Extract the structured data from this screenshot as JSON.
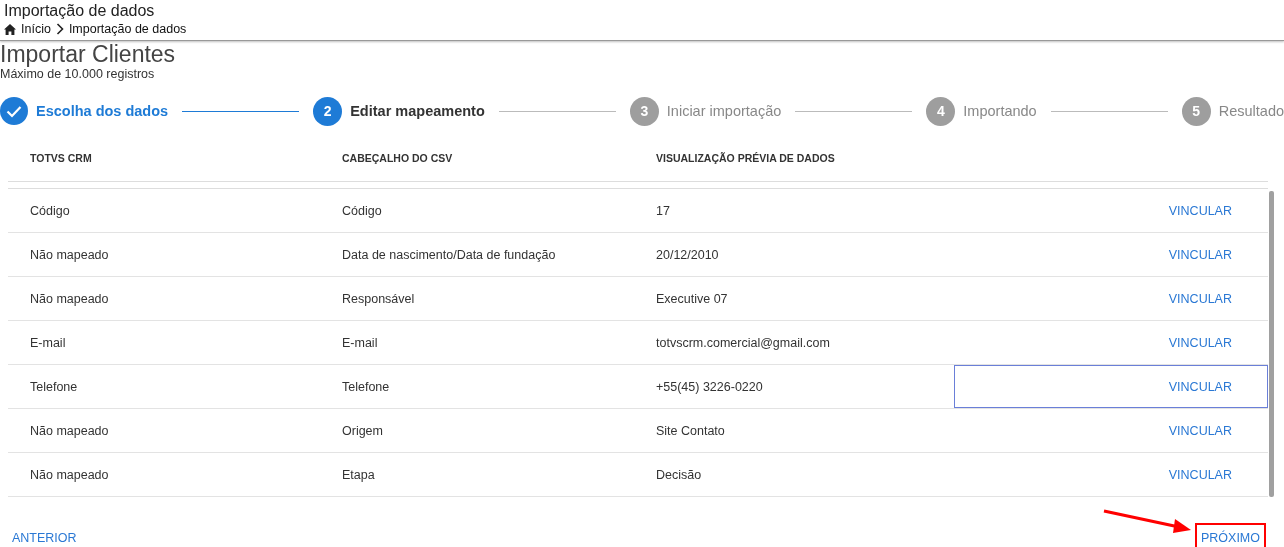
{
  "header": {
    "title": "Importação de dados",
    "breadcrumb": [
      "Início",
      "Importação de dados"
    ]
  },
  "page": {
    "title": "Importar Clientes",
    "subtitle": "Máximo de 10.000 registros"
  },
  "steps": [
    {
      "label": "Escolha dos dados",
      "completed": true,
      "selected": false
    },
    {
      "number": "2",
      "label": "Editar mapeamento",
      "completed": false,
      "selected": true
    },
    {
      "number": "3",
      "label": "Iniciar importação",
      "completed": false,
      "selected": false
    },
    {
      "number": "4",
      "label": "Importando",
      "completed": false,
      "selected": false
    },
    {
      "number": "5",
      "label": "Resultado",
      "completed": false,
      "selected": false
    }
  ],
  "table": {
    "columns": [
      "TOTVS CRM",
      "CABEÇALHO DO CSV",
      "VISUALIZAÇÃO PRÉVIA DE DADOS"
    ],
    "rows": [
      {
        "field": "Código",
        "csv_header": "Código",
        "preview": "17",
        "action": "VINCULAR",
        "focused": false
      },
      {
        "field": "Não mapeado",
        "csv_header": "Data de nascimento/Data de fundação",
        "preview": "20/12/2010",
        "action": "VINCULAR",
        "focused": false
      },
      {
        "field": "Não mapeado",
        "csv_header": "Responsável",
        "preview": "Executive 07",
        "action": "VINCULAR",
        "focused": false
      },
      {
        "field": "E-mail",
        "csv_header": "E-mail",
        "preview": "totvscrm.comercial@gmail.com",
        "action": "VINCULAR",
        "focused": false
      },
      {
        "field": "Telefone",
        "csv_header": "Telefone",
        "preview": "+55(45) 3226-0220",
        "action": "VINCULAR",
        "focused": true
      },
      {
        "field": "Não mapeado",
        "csv_header": "Origem",
        "preview": "Site Contato",
        "action": "VINCULAR",
        "focused": false
      },
      {
        "field": "Não mapeado",
        "csv_header": "Etapa",
        "preview": "Decisão",
        "action": "VINCULAR",
        "focused": false
      }
    ]
  },
  "footer": {
    "previous": "ANTERIOR",
    "next": {
      "label": "PRÓXIMO",
      "highlighted": true
    }
  }
}
